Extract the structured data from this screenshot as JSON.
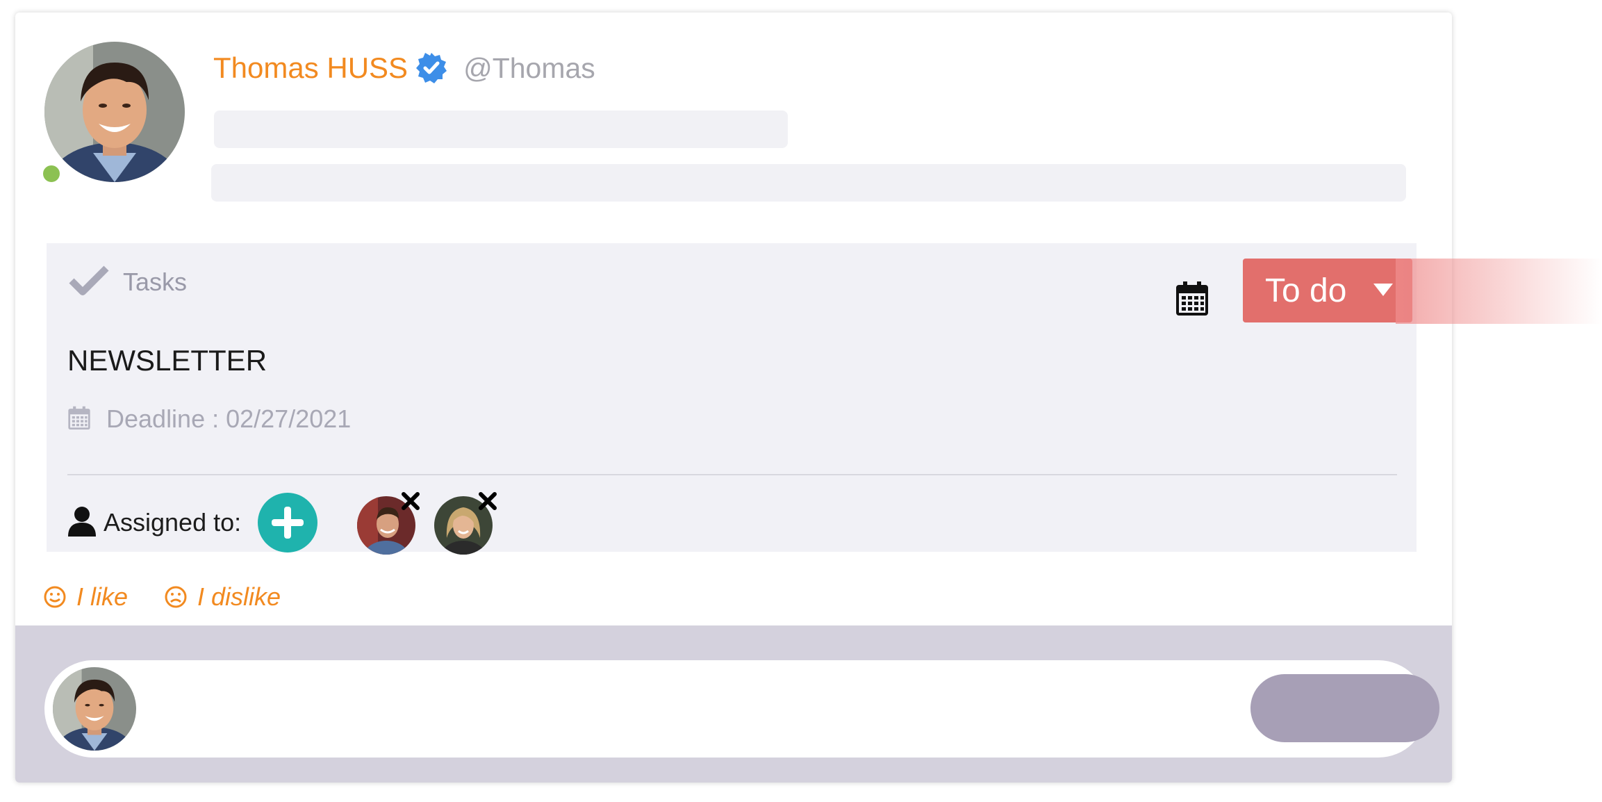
{
  "post": {
    "author_name": "Thomas HUSS",
    "author_handle": "@Thomas",
    "verified": true,
    "online": true
  },
  "task": {
    "section_label": "Tasks",
    "status": "To do",
    "title": "NEWSLETTER",
    "deadline": "Deadline : 02/27/2021",
    "assigned_label": "Assigned to:",
    "assignees_count": 2
  },
  "reactions": {
    "like_label": "I like",
    "dislike_label": "I dislike"
  },
  "colors": {
    "accent_orange": "#f28a20",
    "status_red": "#e26f6c",
    "add_teal": "#1fb3ad",
    "online_green": "#8cc152",
    "panel_bg": "#f1f1f6",
    "comment_bar": "#d4d1dd",
    "send_button": "#a79fb6"
  },
  "icons": {
    "verified": "verified-badge-icon",
    "tasks": "checkmark-icon",
    "calendar": "calendar-icon",
    "status_caret": "caret-down-icon",
    "deadline": "calendar-icon",
    "assign": "user-icon",
    "add": "plus-icon",
    "remove": "close-icon",
    "like": "smile-icon",
    "dislike": "frown-icon"
  }
}
